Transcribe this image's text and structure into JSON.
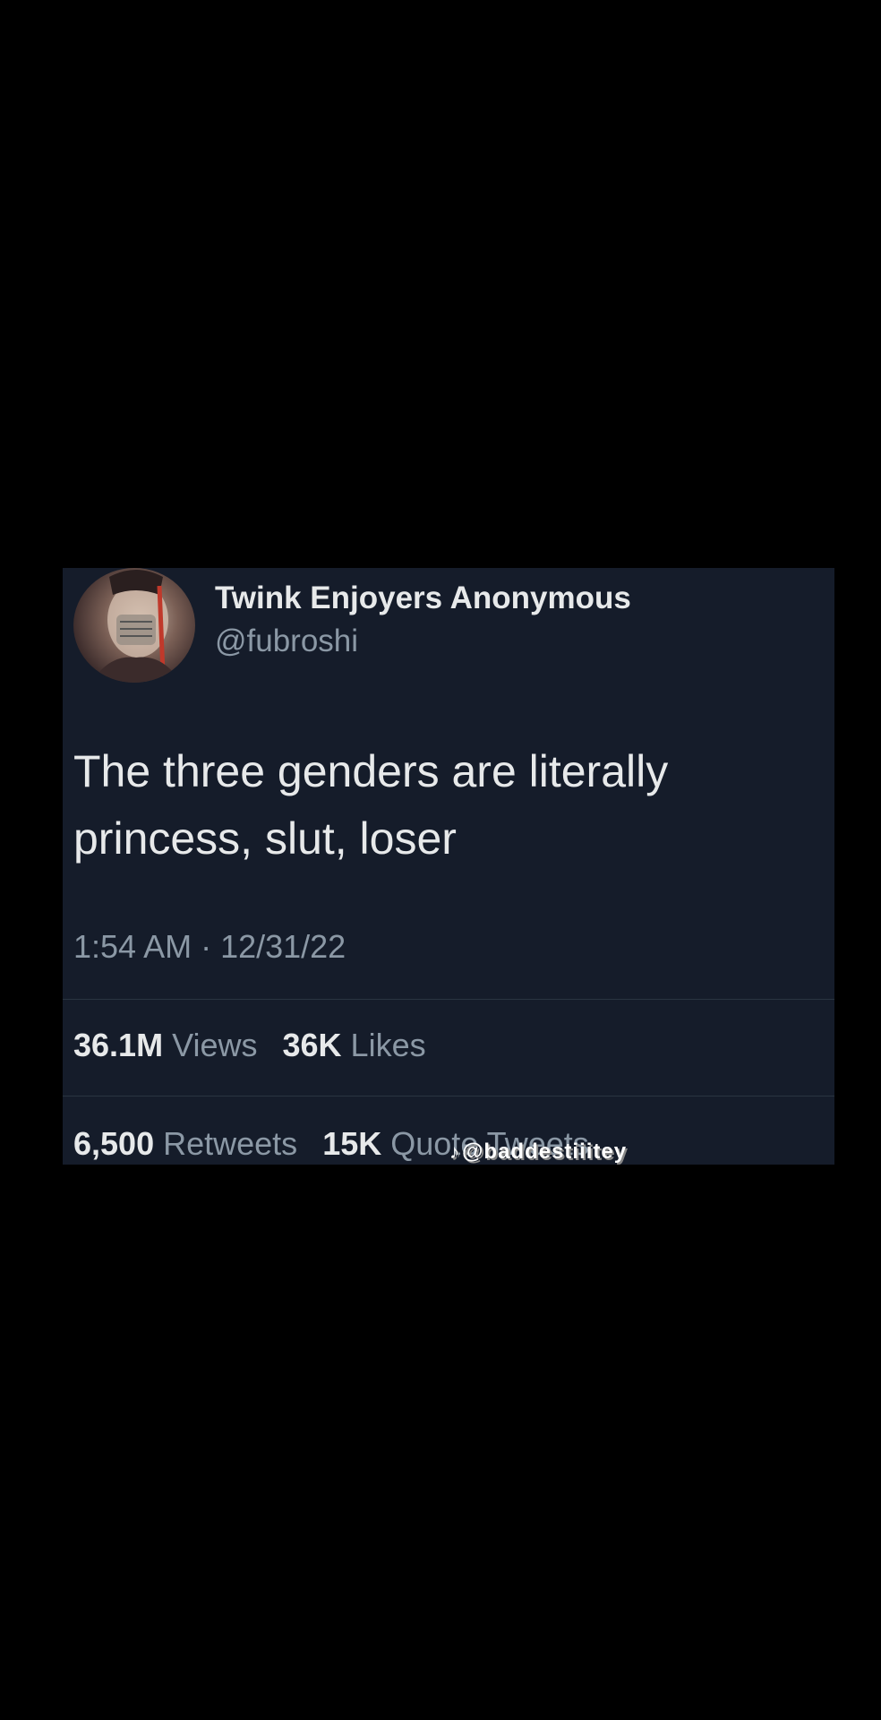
{
  "tweet": {
    "display_name": "Twink Enjoyers Anonymous",
    "handle": "@fubroshi",
    "text_line1": "The three genders are literally",
    "text_line2": "princess, slut, loser",
    "timestamp": "1:54 AM · 12/31/22"
  },
  "stats": {
    "views_count": "36.1M",
    "views_label": "Views",
    "likes_count": "36K",
    "likes_label": "Likes",
    "retweets_count": "6,500",
    "retweets_label": "Retweets",
    "quotes_count": "15K",
    "quotes_label": "Quote Tweets"
  },
  "watermark": {
    "icon": "tiktok-icon",
    "text": "@baddestiiitey"
  },
  "colors": {
    "background": "#000000",
    "card": "#151c2a",
    "primary_text": "#e7e9ea",
    "secondary_text": "#8b98a5"
  }
}
